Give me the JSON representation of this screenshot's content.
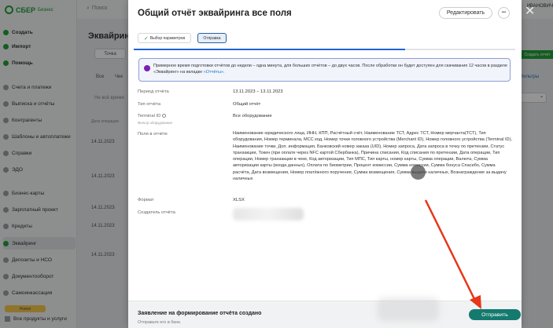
{
  "sidebar": {
    "logo": "СБЕР",
    "logo_sub": "Бизнес",
    "items": [
      {
        "label": "Создать",
        "color": "#21a038"
      },
      {
        "label": "Импорт",
        "color": "#21a038"
      },
      {
        "label": "Помощь",
        "color": "#21a038"
      },
      {
        "label": "Счета и платежи",
        "color": "#9aa0a6"
      },
      {
        "label": "Выписка и отчёты",
        "color": "#9aa0a6"
      },
      {
        "label": "Контрагенты",
        "color": "#9aa0a6"
      },
      {
        "label": "Шаблоны и автоплатежи",
        "color": "#9aa0a6"
      },
      {
        "label": "Справки",
        "color": "#9aa0a6"
      },
      {
        "label": "ЭДО",
        "color": "#9aa0a6"
      },
      {
        "label": "Бизнес-карты",
        "color": "#9aa0a6"
      },
      {
        "label": "Зарплатный проект",
        "color": "#9aa0a6"
      },
      {
        "label": "Кредиты",
        "color": "#9aa0a6"
      },
      {
        "label": "Эквайринг",
        "color": "#21a038"
      },
      {
        "label": "Депозиты и НСО",
        "color": "#9aa0a6"
      },
      {
        "label": "Документооборот",
        "color": "#9aa0a6"
      },
      {
        "label": "Самоинкассация",
        "color": "#9aa0a6"
      }
    ],
    "promo": "Новое",
    "bottom": "Все продукты и услуги"
  },
  "background": {
    "search": "Поиск",
    "title": "Эквайринг",
    "filter": "Точка",
    "tabs": [
      "Все",
      "Чек"
    ],
    "search_hint": "Не всё время",
    "date_head": "Дата операции",
    "dates": [
      "14.11.2023",
      "14.11.2023",
      "14.11.2023",
      "14.11.2023",
      "14.11.2023"
    ],
    "right_button": "Создать отчёт",
    "right_link": "Фильтры",
    "top_right": "ИВАНОВИЧ"
  },
  "modal": {
    "title": "Общий отчёт эквайринга все поля",
    "edit_label": "Редактировать",
    "more_label": "•••",
    "close_label": "✕",
    "steps": [
      "Выбор параметров",
      "Отправка"
    ],
    "alert_text": "Примерное время подготовки отчётов до недели – одна минута, для больших отчётов – до двух часов. После обработки он будет доступен для скачивания 12 часов в разделе «Эквайринг» на вкладке ",
    "alert_link": "«Отчёты».",
    "fields": {
      "period_label": "Период отчёта",
      "period_value": "13.11.2023 – 13.11.2023",
      "type_label": "Тип отчёта",
      "type_value": "Общий отчёт",
      "terminal_label": "Terminal ID",
      "terminal_sub": "Фильтр оборудования",
      "terminal_value": "Все оборудование",
      "fields_label": "Поля в отчёте",
      "fields_value": "Наименование юридического лица, ИНН, КПП, Расчётный счёт, Наименование ТСТ, Адрес ТСТ, Номер мерчанта(ТСТ), Тип оборудования, Номер терминала, МСС код, Номер точки головного устройства (Merchant ID), Номер головного устройства (Terminal ID), Наименование точки, Доп. информация, Банковский номер заказа (UID), Номер запроса, Дата запроса в точку по претензии, Статус транзакции, Токен (при оплате через NFC картой Сбербанка), Причина списания, Код списания по претензии, Дата операции, Тип операции, Номер транзакции в чеке, Код авторизации, Тип МПС, Тип карты, номер карты, Сумма операции, Валюта, Сумма авторизации карты (входа данных), Оплата по биометрии, Процент комиссии, Сумма комиссии, Сумма бонуса Спасибо, Сумма расчёта, Дата возмещения, Номер платёжного поручения, Сумма возмещения, Сумма выдачи наличных, Вознаграждение за выдачу наличных",
      "format_label": "Формат",
      "format_value": "XLSX",
      "creator_label": "Создатель отчёта"
    },
    "footer": {
      "title": "Заявление на формирование отчёта создано",
      "subtitle": "Отправьте его в банк.",
      "send_label": "Отправить"
    }
  },
  "colors": {
    "brand": "#21a038",
    "send_button": "#157a6e",
    "progress": "#1f63d8",
    "annotation_arrow": "#e8361b",
    "alert_dot": "#7a1fb0"
  }
}
